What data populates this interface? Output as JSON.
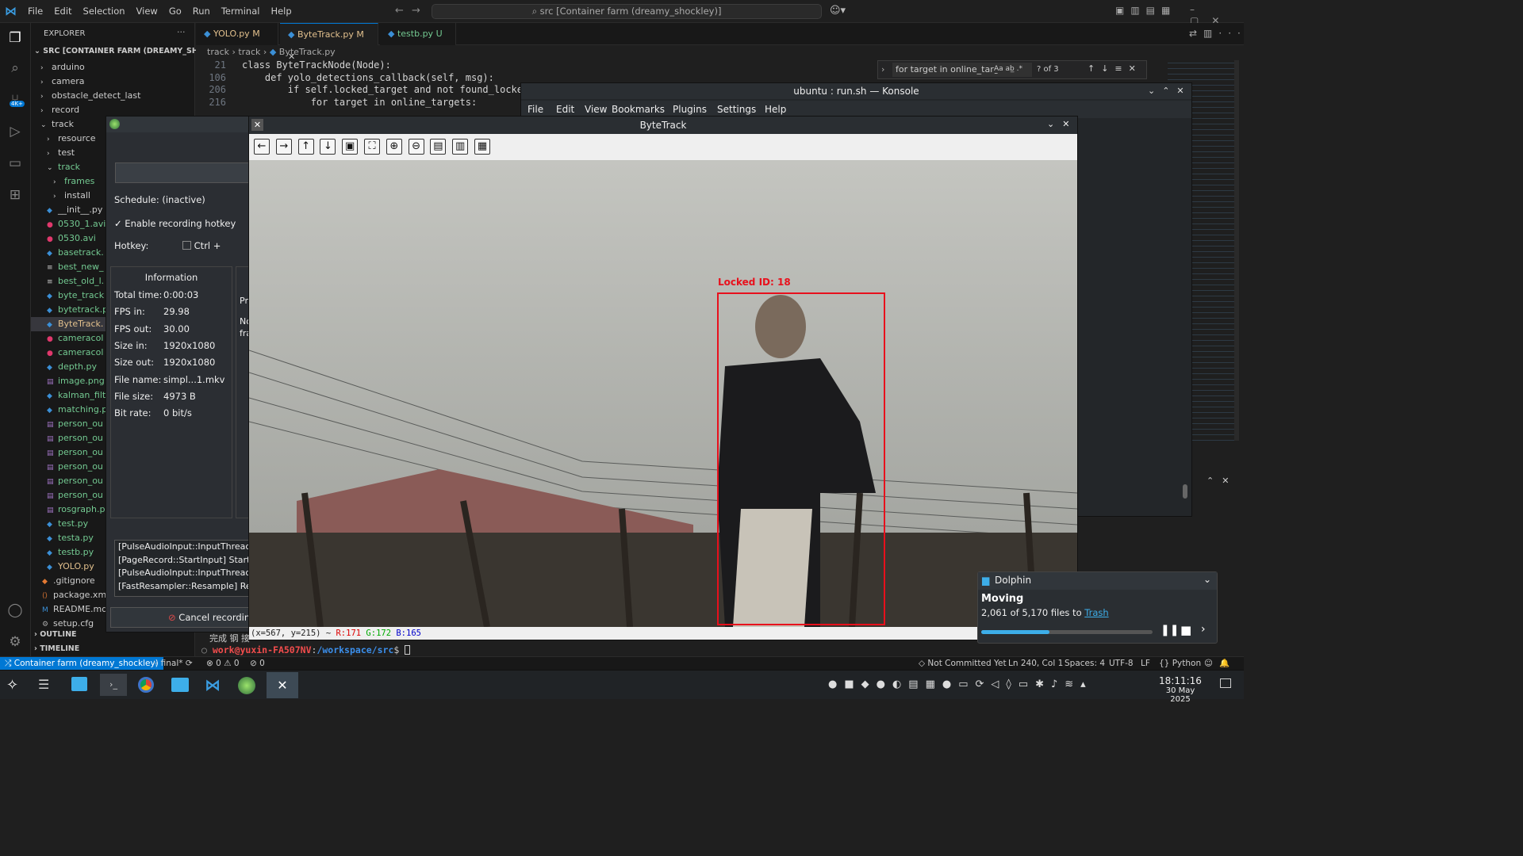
{
  "titlebar": {
    "menu": [
      "File",
      "Edit",
      "Selection",
      "View",
      "Go",
      "Run",
      "Terminal",
      "Help"
    ],
    "command_center": "src [Container farm (dreamy_shockley)]"
  },
  "explorer": {
    "title": "EXPLORER",
    "root": "SRC [CONTAINER FARM (DREAMY_SHOCK...",
    "items": [
      {
        "label": "arduino",
        "type": "folder-closed",
        "color": "#cccccc"
      },
      {
        "label": "camera",
        "type": "folder-closed",
        "color": "#cccccc"
      },
      {
        "label": "obstacle_detect_last",
        "type": "folder-closed",
        "color": "#cccccc"
      },
      {
        "label": "record",
        "type": "folder-closed",
        "color": "#cccccc"
      },
      {
        "label": "track",
        "type": "folder-open",
        "color": "#cccccc"
      },
      {
        "label": "resource",
        "type": "folder-closed",
        "color": "#cccccc"
      },
      {
        "label": "test",
        "type": "folder-closed",
        "color": "#cccccc"
      },
      {
        "label": "track",
        "type": "folder-open",
        "color": "#73c991"
      },
      {
        "label": "frames",
        "type": "folder-closed",
        "color": "#73c991"
      },
      {
        "label": "install",
        "type": "folder-closed",
        "color": "#cccccc"
      },
      {
        "label": "__init__.py",
        "type": "py",
        "color": "#cccccc"
      },
      {
        "label": "0530_1.avi",
        "type": "video",
        "color": "#73c991"
      },
      {
        "label": "0530.avi",
        "type": "video",
        "color": "#73c991"
      },
      {
        "label": "basetrack.",
        "type": "py",
        "color": "#73c991"
      },
      {
        "label": "best_new_",
        "type": "txt",
        "color": "#73c991"
      },
      {
        "label": "best_old_l.",
        "type": "txt",
        "color": "#73c991"
      },
      {
        "label": "byte_track",
        "type": "py",
        "color": "#73c991"
      },
      {
        "label": "bytetrack.p",
        "type": "py",
        "color": "#73c991"
      },
      {
        "label": "ByteTrack.",
        "type": "py",
        "color": "#e2c08d"
      },
      {
        "label": "cameracol",
        "type": "video",
        "color": "#73c991"
      },
      {
        "label": "cameracol",
        "type": "video",
        "color": "#73c991"
      },
      {
        "label": "depth.py",
        "type": "py",
        "color": "#73c991"
      },
      {
        "label": "image.png",
        "type": "img",
        "color": "#73c991"
      },
      {
        "label": "kalman_filt",
        "type": "py",
        "color": "#73c991"
      },
      {
        "label": "matching.p",
        "type": "py",
        "color": "#73c991"
      },
      {
        "label": "person_ou",
        "type": "img",
        "color": "#73c991"
      },
      {
        "label": "person_ou",
        "type": "img",
        "color": "#73c991"
      },
      {
        "label": "person_ou",
        "type": "img",
        "color": "#73c991"
      },
      {
        "label": "person_ou",
        "type": "img",
        "color": "#73c991"
      },
      {
        "label": "person_ou",
        "type": "img",
        "color": "#73c991"
      },
      {
        "label": "person_ou",
        "type": "img",
        "color": "#73c991"
      },
      {
        "label": "rosgraph.p",
        "type": "img",
        "color": "#73c991"
      },
      {
        "label": "test.py",
        "type": "py",
        "color": "#73c991"
      },
      {
        "label": "testa.py",
        "type": "py",
        "color": "#73c991"
      },
      {
        "label": "testb.py",
        "type": "py",
        "color": "#73c991"
      },
      {
        "label": "YOLO.py",
        "type": "py",
        "color": "#e2c08d"
      },
      {
        "label": ".gitignore",
        "type": "git",
        "color": "#cccccc"
      },
      {
        "label": "package.xml",
        "type": "xml",
        "color": "#cccccc"
      },
      {
        "label": "README.md",
        "type": "md",
        "color": "#cccccc"
      },
      {
        "label": "setup.cfg",
        "type": "cfg",
        "color": "#cccccc"
      }
    ],
    "outline": "OUTLINE",
    "timeline": "TIMELINE"
  },
  "tabs": [
    {
      "name": "YOLO.py",
      "status": "M",
      "color": "#e2c08d"
    },
    {
      "name": "ByteTrack.py",
      "status": "M",
      "color": "#e2c08d"
    },
    {
      "name": "testb.py",
      "status": "U",
      "color": "#73c991"
    }
  ],
  "breadcrumb": [
    "track",
    "track",
    "ByteTrack.py"
  ],
  "code": [
    {
      "ln": "21",
      "text": "class ByteTrackNode(Node):"
    },
    {
      "ln": "106",
      "text": "    def yolo_detections_callback(self, msg):"
    },
    {
      "ln": "206",
      "text": "        if self.locked_target and not found_locked_"
    },
    {
      "ln": "216",
      "text": "            for target in online_targets:"
    }
  ],
  "find": {
    "query": "for target in online_targ",
    "result": "? of 3"
  },
  "obs": {
    "schedule": "Schedule: (inactive)",
    "enable_hotkey": "Enable recording hotkey",
    "hotkey_label": "Hotkey:",
    "hotkey_value": "Ctrl +",
    "info_title": "Information",
    "info": [
      {
        "k": "Total time:",
        "v": "0:00:03"
      },
      {
        "k": "FPS in:",
        "v": "29.98"
      },
      {
        "k": "FPS out:",
        "v": "30.00"
      },
      {
        "k": "Size in:",
        "v": "1920x1080"
      },
      {
        "k": "Size out:",
        "v": "1920x1080"
      },
      {
        "k": "File name:",
        "v": "simpl...1.mkv"
      },
      {
        "k": "File size:",
        "v": "4973 B"
      },
      {
        "k": "Bit rate:",
        "v": "0 bit/s"
      }
    ],
    "log": [
      "[PulseAudioInput::InputThread",
      "[PageRecord::StartInput] Starte",
      "[PulseAudioInput::InputThread",
      "[FastResampler::Resample] Res"
    ],
    "cancel": "Cancel recording",
    "side_pr": "Pr",
    "side_no": "No",
    "side_fra": "fra"
  },
  "konsole": {
    "title": "ubuntu : run.sh — Konsole",
    "menu": [
      "File",
      "Edit",
      "View",
      "Bookmarks",
      "Plugins",
      "Settings",
      "Help"
    ]
  },
  "bytetrack": {
    "title": "ByteTrack",
    "toolbar_icons": [
      "arrow-left-icon",
      "arrow-right-icon",
      "arrow-up-icon",
      "arrow-down-icon",
      "image-icon",
      "image-fit-icon",
      "zoom-in-icon",
      "zoom-out-icon",
      "save-icon",
      "copy-icon",
      "properties-icon"
    ],
    "locked_label": "Locked ID: 18",
    "status": {
      "coords": "(x=567, y=215) ~",
      "r": "R:171",
      "g": "G:172",
      "b": "B:165"
    }
  },
  "terminal": {
    "cn_text": "完成 钢 接",
    "user": "work@yuxin-FA507NV",
    "path": "/workspace/src",
    "prompt": "$"
  },
  "dolphin": {
    "app": "Dolphin",
    "title": "Moving",
    "progress_text": "2,061 of 5,170 files to",
    "link": "Trash",
    "progress": 0.4
  },
  "statusbar": {
    "remote": "Container farm (dreamy_shockley)",
    "branch": "final*",
    "problems": "⊗ 0 ⚠ 0",
    "ports": "0",
    "commit": "Not Committed Yet",
    "position": "Ln 240, Col 1",
    "spaces": "Spaces: 4",
    "encoding": "UTF-8",
    "eol": "LF",
    "language": "Python"
  },
  "taskbar": {
    "time": "18:11:16",
    "date": "30 May 2025"
  },
  "colors": {
    "accent": "#0078d4",
    "box": "#e8101c",
    "modified": "#e2c08d",
    "untracked": "#73c991"
  }
}
